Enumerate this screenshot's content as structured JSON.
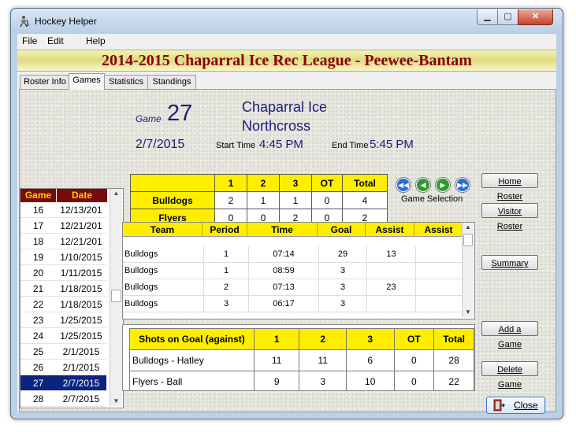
{
  "window": {
    "title": "Hockey Helper"
  },
  "menu": [
    "File",
    "Edit",
    "Help"
  ],
  "league_title": "2014-2015 Chaparral Ice Rec League - Peewee-Bantam",
  "tabs": [
    "Roster Info",
    "Games",
    "Statistics",
    "Standings"
  ],
  "game": {
    "label": "Game",
    "number": "27",
    "home_team": "Chaparral Ice",
    "visitor_team": "Northcross",
    "date": "2/7/2015",
    "start_time_label": "Start Time",
    "start_time": "4:45 PM",
    "end_time_label": "End Time",
    "end_time": "5:45 PM"
  },
  "game_list": {
    "headers": [
      "Game",
      "Date"
    ],
    "rows": [
      {
        "game": "16",
        "date": "12/13/201"
      },
      {
        "game": "17",
        "date": "12/21/201"
      },
      {
        "game": "18",
        "date": "12/21/201"
      },
      {
        "game": "19",
        "date": "1/10/2015"
      },
      {
        "game": "20",
        "date": "1/11/2015"
      },
      {
        "game": "21",
        "date": "1/18/2015"
      },
      {
        "game": "22",
        "date": "1/18/2015"
      },
      {
        "game": "23",
        "date": "1/25/2015"
      },
      {
        "game": "24",
        "date": "1/25/2015"
      },
      {
        "game": "25",
        "date": "2/1/2015"
      },
      {
        "game": "26",
        "date": "2/1/2015"
      },
      {
        "game": "27",
        "date": "2/7/2015"
      },
      {
        "game": "28",
        "date": "2/7/2015"
      }
    ],
    "selected_game": "27"
  },
  "scoreboard": {
    "headers": [
      "",
      "1",
      "2",
      "3",
      "OT",
      "Total"
    ],
    "rows": [
      {
        "team": "Bulldogs",
        "p1": "2",
        "p2": "1",
        "p3": "1",
        "ot": "0",
        "total": "4"
      },
      {
        "team": "Flyers",
        "p1": "0",
        "p2": "0",
        "p3": "2",
        "ot": "0",
        "total": "2"
      }
    ]
  },
  "game_selection_label": "Game Selection",
  "goals": {
    "headers": [
      "Team",
      "Period",
      "Time",
      "Goal",
      "Assist",
      "Assist"
    ],
    "rows": [
      {
        "team": "Bulldogs",
        "period": "1",
        "time": "07:14",
        "goal": "29",
        "assist1": "13",
        "assist2": ""
      },
      {
        "team": "Bulldogs",
        "period": "1",
        "time": "08:59",
        "goal": "3",
        "assist1": "",
        "assist2": ""
      },
      {
        "team": "Bulldogs",
        "period": "2",
        "time": "07:13",
        "goal": "3",
        "assist1": "23",
        "assist2": ""
      },
      {
        "team": "Bulldogs",
        "period": "3",
        "time": "06:17",
        "goal": "3",
        "assist1": "",
        "assist2": ""
      }
    ]
  },
  "shots": {
    "headers": [
      "Shots on Goal (against)",
      "1",
      "2",
      "3",
      "OT",
      "Total"
    ],
    "rows": [
      {
        "name": "Bulldogs - Hatley",
        "p1": "11",
        "p2": "11",
        "p3": "6",
        "ot": "0",
        "total": "28"
      },
      {
        "name": "Flyers - Ball",
        "p1": "9",
        "p2": "3",
        "p3": "10",
        "ot": "0",
        "total": "22"
      }
    ]
  },
  "buttons": {
    "home_roster": "Home Roster",
    "visitor_roster": "Visitor Roster",
    "summary": "Summary",
    "add_game": "Add a Game",
    "delete_game": "Delete Game",
    "close": "Close"
  },
  "colors": {
    "league_title": "#8b0000",
    "game_header_bg": "#7a0a0a",
    "game_header_text": "#ffd200",
    "table_header": "#ffee00",
    "selected_row": "#0a2480",
    "nav_blue": "#2a6bd6",
    "nav_green": "#2e9a2e"
  }
}
